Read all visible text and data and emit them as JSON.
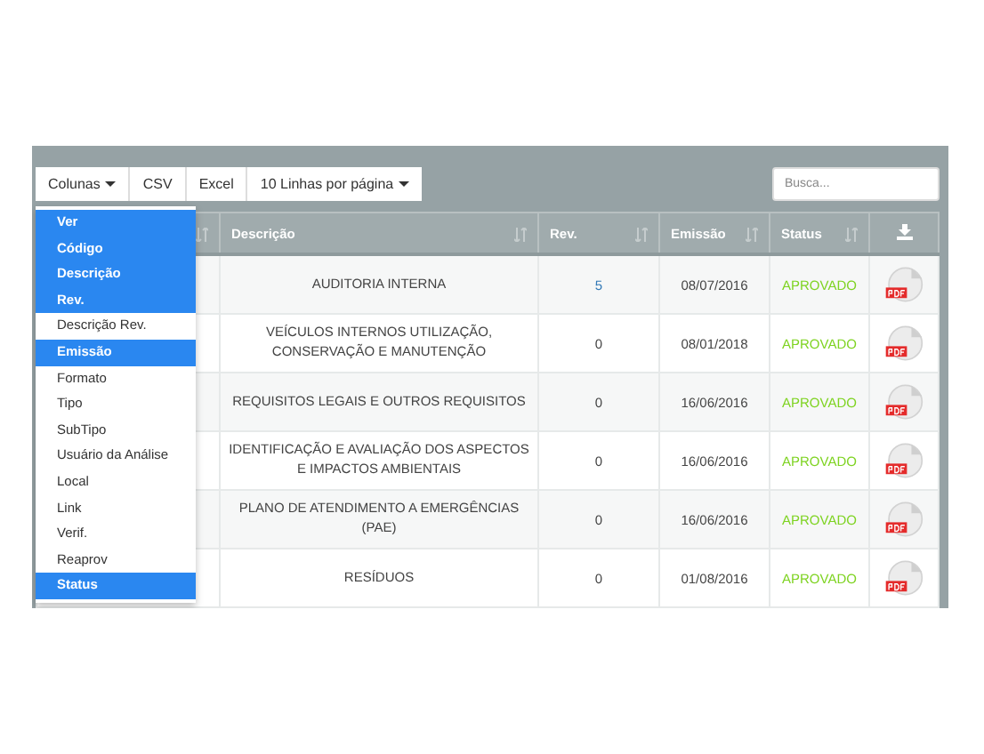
{
  "toolbar": {
    "buttons": [
      {
        "label": "Colunas",
        "caret": true
      },
      {
        "label": "CSV",
        "caret": false
      },
      {
        "label": "Excel",
        "caret": false
      },
      {
        "label": "10 Linhas por página",
        "caret": true
      }
    ],
    "search": {
      "placeholder": "Busca..."
    }
  },
  "column_menu": [
    {
      "label": "Ver",
      "selected": true
    },
    {
      "label": "Código",
      "selected": true
    },
    {
      "label": "Descrição",
      "selected": true
    },
    {
      "label": "Rev.",
      "selected": true
    },
    {
      "label": "Descrição Rev.",
      "selected": false
    },
    {
      "label": "Emissão",
      "selected": true
    },
    {
      "label": "Formato",
      "selected": false
    },
    {
      "label": "Tipo",
      "selected": false
    },
    {
      "label": "SubTipo",
      "selected": false
    },
    {
      "label": "Usuário da Análise",
      "selected": false
    },
    {
      "label": "Local",
      "selected": false
    },
    {
      "label": "Link",
      "selected": false
    },
    {
      "label": "Verif.",
      "selected": false
    },
    {
      "label": "Reaprov",
      "selected": false
    },
    {
      "label": "Status",
      "selected": true
    }
  ],
  "table": {
    "columns": [
      {
        "label": "Descrição"
      },
      {
        "label": "Rev."
      },
      {
        "label": "Emissão"
      },
      {
        "label": "Status"
      }
    ],
    "rows": [
      {
        "description": "AUDITORIA INTERNA",
        "rev": "5",
        "emission": "08/07/2016",
        "status": "APROVADO"
      },
      {
        "description": "VEÍCULOS INTERNOS UTILIZAÇÃO, CONSERVAÇÃO E MANUTENÇÃO",
        "rev": "0",
        "emission": "08/01/2018",
        "status": "APROVADO"
      },
      {
        "description": "REQUISITOS LEGAIS E OUTROS REQUISITOS",
        "rev": "0",
        "emission": "16/06/2016",
        "status": "APROVADO"
      },
      {
        "description": "IDENTIFICAÇÃO E AVALIAÇÃO DOS ASPECTOS E IMPACTOS AMBIENTAIS",
        "rev": "0",
        "emission": "16/06/2016",
        "status": "APROVADO"
      },
      {
        "description": "PLANO DE ATENDIMENTO A EMERGÊNCIAS (PAE)",
        "rev": "0",
        "emission": "16/06/2016",
        "status": "APROVADO"
      },
      {
        "description": "RESÍDUOS",
        "rev": "0",
        "emission": "01/08/2016",
        "status": "APROVADO"
      }
    ]
  }
}
